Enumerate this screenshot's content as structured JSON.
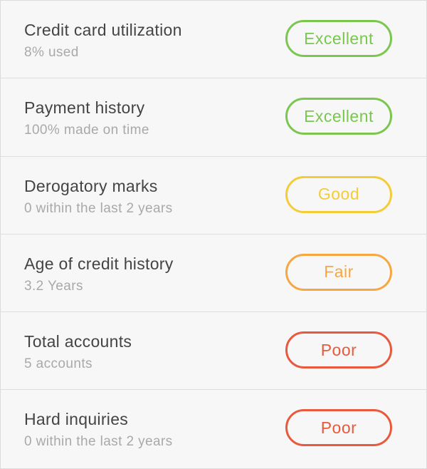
{
  "factors": [
    {
      "title": "Credit card utilization",
      "detail": "8% used",
      "rating": "Excellent",
      "color": "#7ac74f"
    },
    {
      "title": "Payment history",
      "detail": "100% made on time",
      "rating": "Excellent",
      "color": "#7ac74f"
    },
    {
      "title": "Derogatory marks",
      "detail": "0 within the last 2 years",
      "rating": "Good",
      "color": "#f4cc3a"
    },
    {
      "title": "Age of credit history",
      "detail": "3.2 Years",
      "rating": "Fair",
      "color": "#f6a742"
    },
    {
      "title": "Total accounts",
      "detail": "5 accounts",
      "rating": "Poor",
      "color": "#e8593d"
    },
    {
      "title": "Hard inquiries",
      "detail": "0 within the last 2 years",
      "rating": "Poor",
      "color": "#e8593d"
    }
  ]
}
